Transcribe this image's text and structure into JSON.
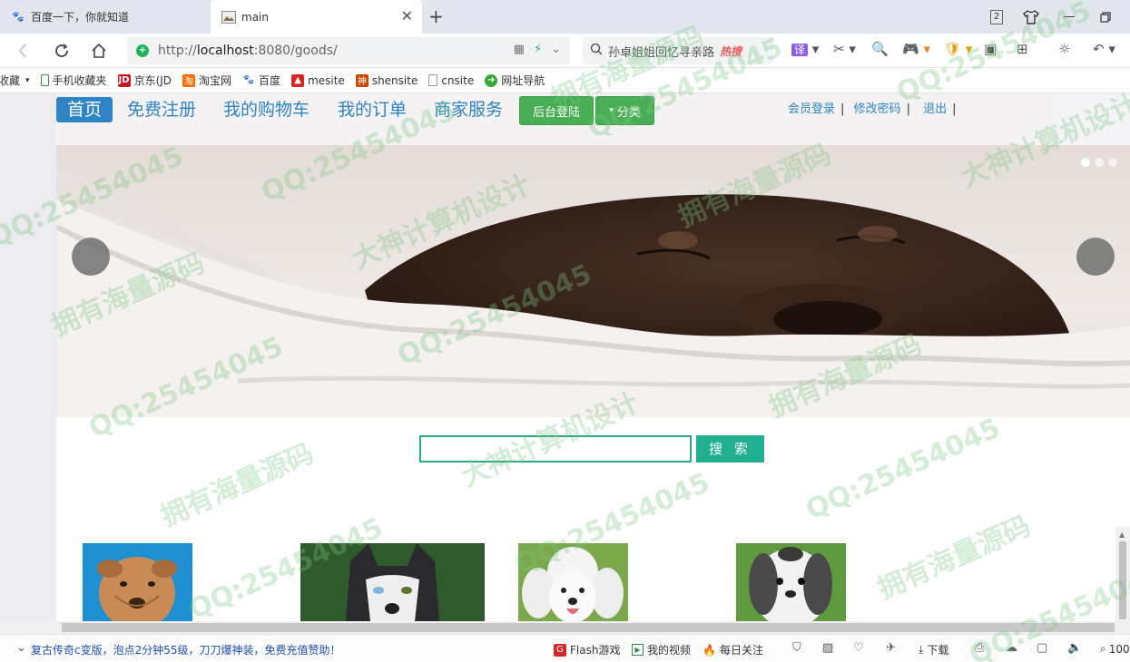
{
  "browser": {
    "tabs": [
      {
        "title": "百度一下，你就知道",
        "active": false
      },
      {
        "title": "main",
        "active": true
      }
    ],
    "tab_count_badge": "2",
    "url_scheme_prefix": "http://",
    "url_host": "localhost",
    "url_path": ":8080/goods/",
    "search_text": "孙卓姐姐回忆寻亲路",
    "search_hot_label": "热搜"
  },
  "bookmarks": [
    {
      "label": "收藏",
      "icon": "star-icon"
    },
    {
      "label": "手机收藏夹",
      "icon": "phone-icon"
    },
    {
      "label": "京东(JD",
      "icon": "jd-icon"
    },
    {
      "label": "淘宝网",
      "icon": "taobao-icon"
    },
    {
      "label": "百度",
      "icon": "baidu-icon"
    },
    {
      "label": "mesite",
      "icon": "mesite-icon"
    },
    {
      "label": "shensite",
      "icon": "shensite-icon"
    },
    {
      "label": "cnsite",
      "icon": "page-icon"
    },
    {
      "label": "网址导航",
      "icon": "nav-icon"
    }
  ],
  "site_nav": {
    "home": "首页",
    "register": "免费注册",
    "cart": "我的购物车",
    "orders": "我的订单",
    "merchant": "商家服务",
    "admin_login": "后台登陆",
    "category": "分类",
    "member_login": "会员登录",
    "change_password": "修改密码",
    "logout": "退出",
    "separator": "|"
  },
  "search": {
    "placeholder": "",
    "button_label": "搜 索"
  },
  "banner": {
    "slide_count": 3,
    "active_slide": 1
  },
  "products": [
    {
      "name": "shar-pei"
    },
    {
      "name": "husky"
    },
    {
      "name": "poodle"
    },
    {
      "name": "shih-tzu"
    }
  ],
  "statusbar": {
    "news": "复古传奇c变版，泡点2分钟55级，刀刀爆神装，免费充值赞助！",
    "flash_games": "Flash游戏",
    "my_videos": "我的视频",
    "daily": "每日关注",
    "download": "下载",
    "zoom": "100"
  },
  "watermark": {
    "texts": [
      "QQ:25454045",
      "大神计算机设计",
      "拥有海量源码"
    ]
  },
  "colors": {
    "nav_blue": "#2e84c4",
    "green_button": "#4aae56",
    "search_teal": "#20b08f"
  }
}
